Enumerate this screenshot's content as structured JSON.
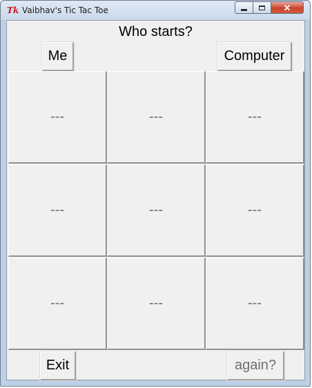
{
  "window": {
    "title": "Vaibhav's Tic Tac Toe",
    "app_icon_label": "Tk"
  },
  "header": {
    "prompt": "Who starts?"
  },
  "buttons": {
    "me": "Me",
    "computer": "Computer",
    "exit": "Exit",
    "again": "again?"
  },
  "board": {
    "cells": [
      "---",
      "---",
      "---",
      "---",
      "---",
      "---",
      "---",
      "---",
      "---"
    ]
  },
  "icons": {
    "minimize": "minimize-icon",
    "maximize": "maximize-icon",
    "close": "close-icon"
  }
}
